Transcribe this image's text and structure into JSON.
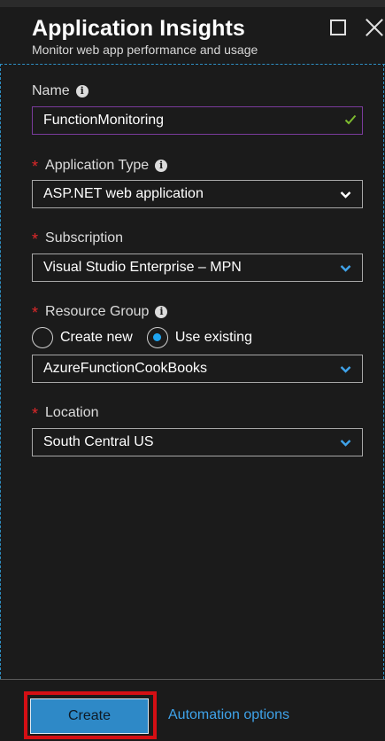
{
  "header": {
    "title": "Application Insights",
    "subtitle": "Monitor web app performance and usage"
  },
  "form": {
    "name": {
      "label": "Name",
      "value": "FunctionMonitoring"
    },
    "application_type": {
      "label": "Application Type",
      "value": "ASP.NET web application"
    },
    "subscription": {
      "label": "Subscription",
      "value": "Visual Studio Enterprise – MPN"
    },
    "resource_group": {
      "label": "Resource Group",
      "options": [
        "Create new",
        "Use existing"
      ],
      "selected": "Use existing",
      "value": "AzureFunctionCookBooks"
    },
    "location": {
      "label": "Location",
      "value": "South Central US"
    }
  },
  "footer": {
    "create_label": "Create",
    "automation_label": "Automation options"
  },
  "colors": {
    "accent": "#2e89c7",
    "link": "#3fa3ea",
    "required": "#e0282a",
    "valid_check": "#7dbb2f",
    "highlight": "#d40f14"
  },
  "icons": [
    "maximize-icon",
    "close-icon",
    "info-icon",
    "checkmark-icon",
    "chevron-down-icon"
  ]
}
